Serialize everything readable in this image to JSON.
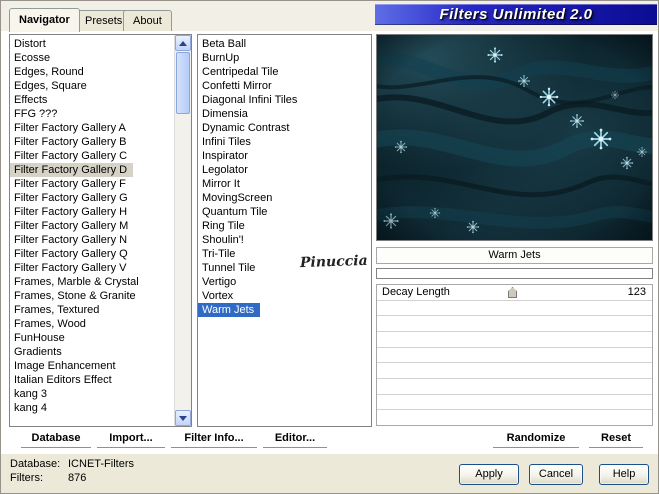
{
  "window": {
    "title": "Filters Unlimited 2.0"
  },
  "tabs": {
    "navigator": "Navigator",
    "presets": "Presets",
    "about": "About"
  },
  "categories": {
    "selected": "Filter Factory Gallery D",
    "items": [
      "Distort",
      "Ecosse",
      "Edges, Round",
      "Edges, Square",
      "Effects",
      "FFG ???",
      "Filter Factory Gallery A",
      "Filter Factory Gallery B",
      "Filter Factory Gallery C",
      "Filter Factory Gallery D",
      "Filter Factory Gallery F",
      "Filter Factory Gallery G",
      "Filter Factory Gallery H",
      "Filter Factory Gallery M",
      "Filter Factory Gallery N",
      "Filter Factory Gallery Q",
      "Filter Factory Gallery V",
      "Frames, Marble & Crystal",
      "Frames, Stone & Granite",
      "Frames, Textured",
      "Frames, Wood",
      "FunHouse",
      "Gradients",
      "Image Enhancement",
      "Italian Editors Effect",
      "kang 3",
      "kang 4"
    ]
  },
  "filters": {
    "selected": "Warm Jets",
    "items": [
      "Beta Ball",
      "BurnUp",
      "Centripedal Tile",
      "Confetti Mirror",
      "Diagonal Infini Tiles",
      "Dimensia",
      "Dynamic Contrast",
      "Infini Tiles",
      "Inspirator",
      "Legolator",
      "Mirror It",
      "MovingScreen",
      "Quantum Tile",
      "Ring Tile",
      "Shoulin'!",
      "Tri-Tile",
      "Tunnel Tile",
      "Vertigo",
      "Vortex",
      "Warm Jets"
    ]
  },
  "preview": {
    "caption": "Warm Jets"
  },
  "parameters": {
    "rows": [
      {
        "name": "Decay Length",
        "value": "123"
      }
    ]
  },
  "watermark": "Pinuccia",
  "toolbar": {
    "database": "Database",
    "import": "Import...",
    "filter_info": "Filter Info...",
    "editor": "Editor...",
    "randomize": "Randomize",
    "reset": "Reset"
  },
  "status": {
    "database_label": "Database:",
    "database_value": "ICNET-Filters",
    "filters_label": "Filters:",
    "filters_value": "876"
  },
  "buttons": {
    "apply": "Apply",
    "cancel": "Cancel",
    "help": "Help"
  },
  "colors": {
    "selection_blue": "#316ac5",
    "selection_gray": "#d6d2c6",
    "banner_blue": "#1a1ab8",
    "preview_teal": "#0b2129"
  }
}
